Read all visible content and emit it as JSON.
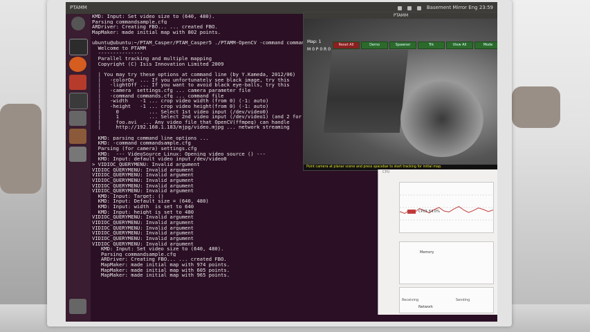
{
  "topbar": {
    "window_title": "PTAMM",
    "ptamm_title": "PTAMM",
    "tray_text": "Basement Mirror Eng 23:59"
  },
  "terminal": {
    "lines": [
      "KMD: Input: Set video size to (640, 480).",
      "Parsing commandsample.cfg",
      "ARDriver: Creating FBO... ... created FBO.",
      "MapMaker: made initial map with 802 points.",
      "",
      "ubuntu@ubuntu:~/PTAM_Casper/PTAM_Casper5 ./PTAMM-OpenCV -command commandsam",
      "  Welcome to PTAMM",
      "  ---------------",
      "  Parallel tracking and multiple mapping",
      "  Copyright (C) Isis Innovation Limited 2009",
      "",
      "  | You may try these options at command line (by Y.Kameda, 2012/06)",
      "  |   -colorOn  ... If you unfortunately see black image, try this",
      "  |   -lightOff ... If you want to avoid black eye-balls, try this",
      "  |   -camera  settings.cfg ... camera parameter file",
      "  |   -command commands.cfg ... command file",
      "  |   -width    -1 ... crop video width (from 0) (-1: auto)",
      "  |   -height   -1 ... crop video height(from 0) (-1: auto)",
      "  |     0          ... Select 1st video input (/dev/video0)",
      "  |     1          ... Select 2nd video input (/dev/video1) (and 2 for 3rd, ...)",
      "  |     foo.avi  ... Any video file that OpenCV(ffmpeg) can handle",
      "  |     http://192.168.1.183/mjpg/video.mjpg ... network streaming",
      "",
      "  KMD: parsing command line options ...",
      "  KMD: -command commandsample.cfg",
      "  Parsing (for camera) settings.cfg",
      "  KMD:  --- VideoSource_Linux: Opening video source () ---",
      "  KMD: Input: default video input /dev/video0",
      "> VIDIOC_QUERYMENU: Invalid argument",
      "VIDIOC_QUERYMENU: Invalid argument",
      "VIDIOC_QUERYMENU: Invalid argument",
      "VIDIOC_QUERYMENU: Invalid argument",
      "VIDIOC_QUERYMENU: Invalid argument",
      "VIDIOC_QUERYMENU: Invalid argument",
      "  KMD: Input: Target: ()",
      "  KMD: Input: Default size = (640, 480)",
      "  KMD: Input: width  is set to 640",
      "  KMD: Input: height is set to 480",
      "VIDIOC_QUERYMENU: Invalid argument",
      "VIDIOC_QUERYMENU: Invalid argument",
      "VIDIOC_QUERYMENU: Invalid argument",
      "VIDIOC_QUERYMENU: Invalid argument",
      "VIDIOC_QUERYMENU: Invalid argument",
      "VIDIOC_QUERYMENU: Invalid argument",
      "   KMD: Input: Set video size to (640, 480).",
      "   Parsing commandsample.cfg",
      "   ARDriver: Creating FBO... ... created FBO.",
      "   MapMaker: made initial map with 974 points.",
      "   MapMaker: made initial map with 605 points.",
      "   MapMaker: made initial map with 965 points.",
      ""
    ]
  },
  "ptamm": {
    "map_label": "Map: 1",
    "map_values": "M 0  P 0  R 0",
    "menu": [
      "Reset All",
      "Demo",
      "Spawner",
      "Trk",
      "View All",
      "Mode"
    ],
    "status": "Point camera at planar scene and press spacebar to start tracking for initial map."
  },
  "sysmon": {
    "title": "CPU",
    "cpu_legend": "CPU1 64.0%",
    "mem_legend": "Memory",
    "net_legend": "Network",
    "footer_left": "Receiving",
    "footer_right": "Sending",
    "cpu_history": [
      42,
      38,
      45,
      40,
      48,
      44,
      39,
      46,
      50,
      43,
      41,
      47,
      52,
      45,
      40,
      44,
      49,
      46,
      42,
      45
    ],
    "colors": {
      "cpu": "#c23a3a",
      "mem": "#9c4a9c"
    }
  }
}
